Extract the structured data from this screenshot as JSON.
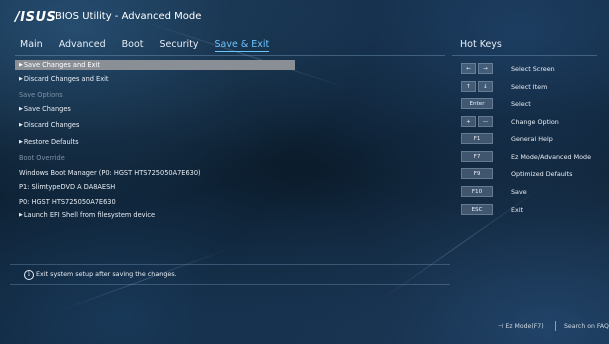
{
  "header": {
    "logo": "/ISUS",
    "title": "BIOS Utility - Advanced Mode"
  },
  "nav": {
    "tabs": [
      "Main",
      "Advanced",
      "Boot",
      "Security",
      "Save & Exit"
    ],
    "active": "Save & Exit"
  },
  "hotkeys": {
    "title": "Hot Keys",
    "items": [
      {
        "keys": [
          "←",
          "→"
        ],
        "desc": "Select Screen"
      },
      {
        "keys": [
          "↑",
          "↓"
        ],
        "desc": "Select Item"
      },
      {
        "keys": [
          "Enter"
        ],
        "desc": "Select"
      },
      {
        "keys": [
          "+",
          "—"
        ],
        "desc": "Change Option"
      },
      {
        "keys": [
          "F1"
        ],
        "desc": "General Help"
      },
      {
        "keys": [
          "F7"
        ],
        "desc": "Ez Mode/Advanced Mode"
      },
      {
        "keys": [
          "F9"
        ],
        "desc": "Optimized Defaults"
      },
      {
        "keys": [
          "F10"
        ],
        "desc": "Save"
      },
      {
        "keys": [
          "ESC"
        ],
        "desc": "Exit"
      }
    ]
  },
  "menu": {
    "items": [
      {
        "label": "Save Changes and Exit",
        "kind": "action",
        "selected": true
      },
      {
        "label": "Discard Changes and Exit",
        "kind": "action"
      },
      {
        "label": "Save Options",
        "kind": "header"
      },
      {
        "label": "Save Changes",
        "kind": "action"
      },
      {
        "label": "Discard Changes",
        "kind": "action"
      },
      {
        "label": "Restore Defaults",
        "kind": "action"
      },
      {
        "label": "Boot Override",
        "kind": "header"
      },
      {
        "label": "Windows Boot Manager (P0: HGST HTS725050A7E630)",
        "kind": "option"
      },
      {
        "label": "P1: SlimtypeDVD A  DA8AESH",
        "kind": "option"
      },
      {
        "label": "P0: HGST HTS725050A7E630",
        "kind": "option"
      },
      {
        "label": "Launch EFI Shell from filesystem device",
        "kind": "action"
      }
    ]
  },
  "status": {
    "info_icon": "i",
    "text": "Exit system setup after saving the changes."
  },
  "footer": {
    "ez_mode": "⊣  Ez Mode(F7)",
    "search": "Search on FAQ"
  },
  "colors": {
    "accent": "#6cc4ff",
    "selected_bg": "#8a8f95",
    "header_text": "#7d90a6"
  }
}
